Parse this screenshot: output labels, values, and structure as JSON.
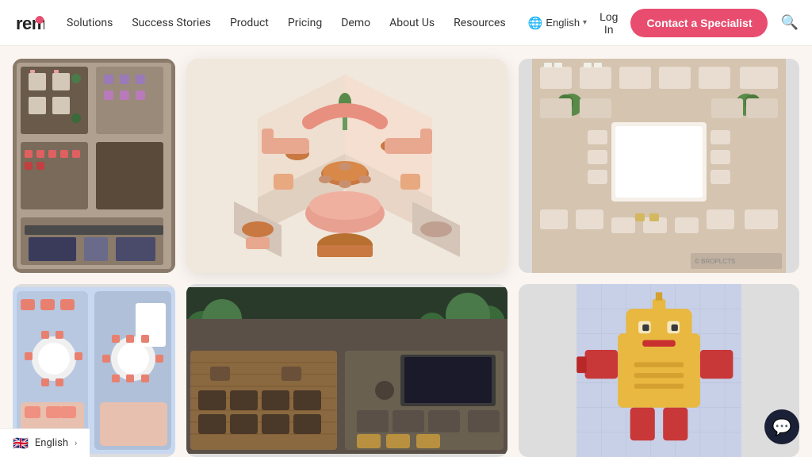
{
  "nav": {
    "logo_text": "remo",
    "links": [
      {
        "label": "Solutions",
        "id": "solutions"
      },
      {
        "label": "Success Stories",
        "id": "success-stories"
      },
      {
        "label": "Product",
        "id": "product"
      },
      {
        "label": "Pricing",
        "id": "pricing"
      },
      {
        "label": "Demo",
        "id": "demo"
      },
      {
        "label": "About Us",
        "id": "about-us"
      },
      {
        "label": "Resources",
        "id": "resources"
      }
    ],
    "lang_label": "English",
    "login_label": "Log In",
    "cta_label": "Contact a Specialist"
  },
  "footer": {
    "lang_label": "English"
  },
  "images": {
    "top_left_alt": "Conference event floor plan top view",
    "top_center_alt": "Isometric virtual event floor plan",
    "top_right_alt": "Outdoor event seating arrangement",
    "bottom_left_alt": "Simple round table floor plan",
    "bottom_center_alt": "Rooftop outdoor event space photo",
    "bottom_right_alt": "Pixelated game character icon"
  }
}
